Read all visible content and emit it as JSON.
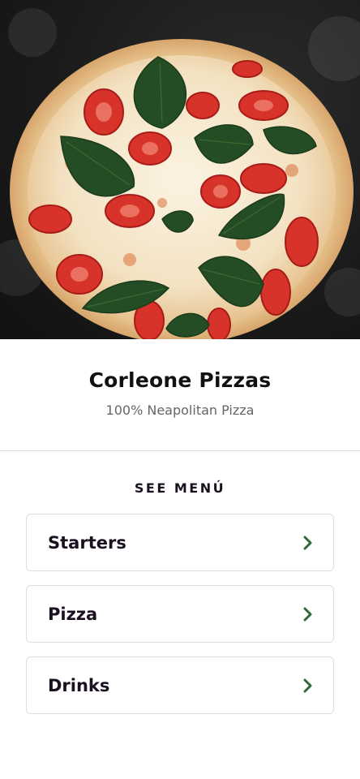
{
  "hero": {
    "image": "pizza-photo"
  },
  "restaurant": {
    "name": "Corleone Pizzas",
    "tagline": "100% Neapolitan Pizza"
  },
  "menu": {
    "heading": "SEE MENÚ",
    "items": [
      {
        "label": "Starters",
        "icon": "chevron-right-icon"
      },
      {
        "label": "Pizza",
        "icon": "chevron-right-icon"
      },
      {
        "label": "Drinks",
        "icon": "chevron-right-icon"
      }
    ]
  },
  "colors": {
    "accent": "#2e6b3c",
    "text": "#1a1020",
    "subtext": "#666666",
    "border": "#dedede"
  }
}
